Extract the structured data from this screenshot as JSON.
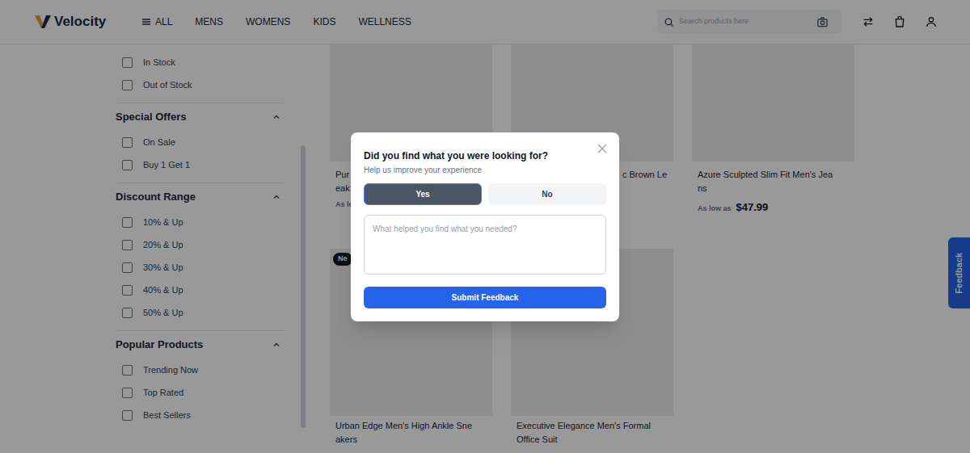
{
  "header": {
    "logo": "Velocity",
    "nav": [
      "ALL",
      "MENS",
      "WOMENS",
      "KIDS",
      "WELLNESS"
    ],
    "search": {
      "placeholder": "Search products here"
    }
  },
  "filters": {
    "stock": [
      {
        "label": "In Stock",
        "checked": false
      },
      {
        "label": "Out of Stock",
        "checked": false
      }
    ],
    "sections": [
      {
        "title": "Special Offers",
        "expanded": true,
        "options": [
          {
            "label": "On Sale",
            "checked": false
          },
          {
            "label": "Buy 1 Get 1",
            "checked": false
          }
        ]
      },
      {
        "title": "Discount Range",
        "expanded": true,
        "options": [
          {
            "label": "10% & Up",
            "checked": false
          },
          {
            "label": "20% & Up",
            "checked": false
          },
          {
            "label": "30% & Up",
            "checked": false
          },
          {
            "label": "40% & Up",
            "checked": false
          },
          {
            "label": "50% & Up",
            "checked": false
          }
        ]
      },
      {
        "title": "Popular Products",
        "expanded": true,
        "options": [
          {
            "label": "Trending Now",
            "checked": false
          },
          {
            "label": "Top Rated",
            "checked": false
          },
          {
            "label": "Best Sellers",
            "checked": false
          }
        ]
      }
    ]
  },
  "products": [
    {
      "title_lines": [
        "Pur",
        "eak"
      ],
      "price": {
        "label": "As lo"
      }
    },
    {
      "title_lines": [
        "c Brown Le"
      ]
    },
    {
      "title_lines": [
        "Azure Sculpted Slim Fit Men's Jea",
        "ns"
      ],
      "price": {
        "label": "As low as",
        "amount": "$47.99"
      }
    },
    {
      "badge": "Ne",
      "title_lines": [
        "Urban Edge Men's High Ankle Sne",
        "akers"
      ]
    },
    {
      "title_lines": [
        "Executive Elegance Men's Formal",
        "Office Suit"
      ]
    }
  ],
  "feedback_tab": {
    "label": "Feedback"
  },
  "modal": {
    "title": "Did you find what you were looking for?",
    "subtitle": "Help us improve your experience",
    "options": [
      {
        "label": "Yes",
        "selected": true
      },
      {
        "label": "No",
        "selected": false
      }
    ],
    "comment": {
      "placeholder": "What helped you find what you needed?"
    },
    "submit": "Submit Feedback"
  }
}
